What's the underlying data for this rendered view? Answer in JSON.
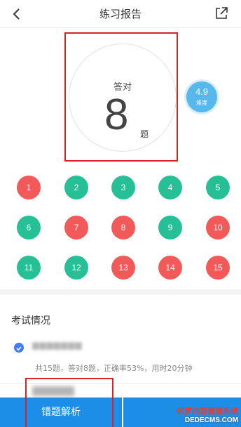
{
  "header": {
    "title": "练习报告"
  },
  "score": {
    "label": "答对",
    "value": "8",
    "unit": "题"
  },
  "difficulty": {
    "value": "4.9",
    "label": "难度"
  },
  "questions": [
    {
      "number": "1",
      "status": "wrong"
    },
    {
      "number": "2",
      "status": "correct"
    },
    {
      "number": "3",
      "status": "correct"
    },
    {
      "number": "4",
      "status": "correct"
    },
    {
      "number": "5",
      "status": "correct"
    },
    {
      "number": "6",
      "status": "correct"
    },
    {
      "number": "7",
      "status": "wrong"
    },
    {
      "number": "8",
      "status": "wrong"
    },
    {
      "number": "9",
      "status": "correct"
    },
    {
      "number": "10",
      "status": "wrong"
    },
    {
      "number": "11",
      "status": "correct"
    },
    {
      "number": "12",
      "status": "correct"
    },
    {
      "number": "13",
      "status": "wrong"
    },
    {
      "number": "14",
      "status": "wrong"
    },
    {
      "number": "15",
      "status": "wrong"
    }
  ],
  "exam": {
    "title": "考试情况",
    "name": "",
    "summary": "共15题，答对8题，正确率53%，用时20分钟"
  },
  "bottom": {
    "wrong_analysis_label": "错题解析"
  },
  "watermark": {
    "line1": "织梦内容管理系统",
    "line2": "DEDECMS.COM"
  },
  "colors": {
    "correct": "#27c096",
    "wrong": "#f25a59",
    "primary": "#1d8ee8",
    "highlight": "#d8222a"
  }
}
